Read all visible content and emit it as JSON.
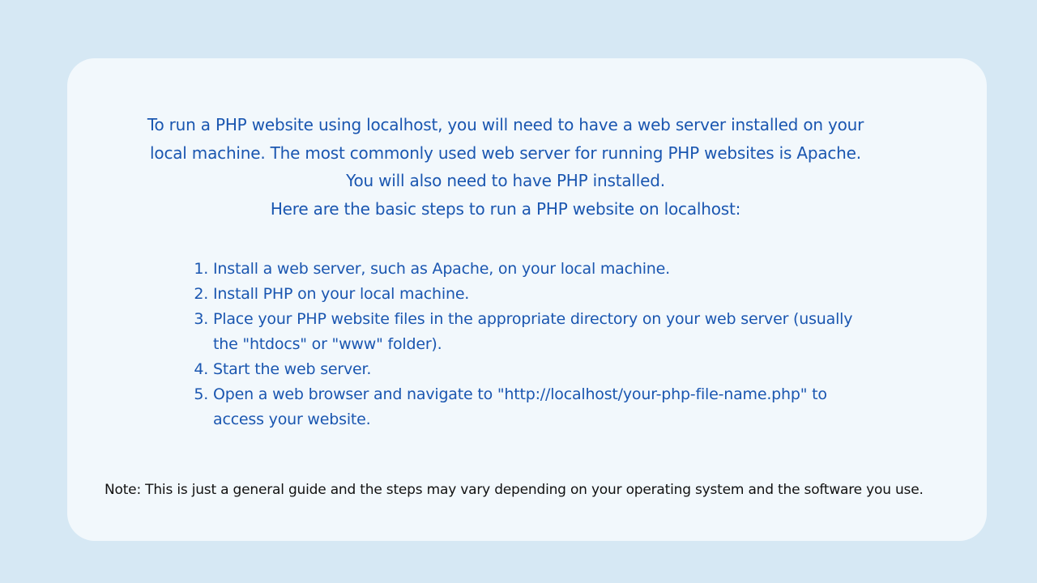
{
  "colors": {
    "background": "#d6e8f4",
    "card": "#f2f8fc",
    "accent_text": "#1a56b0",
    "note_text": "#111111"
  },
  "intro": {
    "paragraph": "To run a PHP website using localhost, you will need to have a web server installed on your local machine. The most commonly used web server for running PHP websites is Apache. You will also need to have PHP installed.",
    "lead": "Here are the basic steps to run a PHP website on localhost:"
  },
  "steps": [
    "Install a web server, such as Apache, on your local machine.",
    "Install PHP on your local machine.",
    "Place your PHP website files in the appropriate directory on your web server (usually the \"htdocs\" or \"www\" folder).",
    "Start the web server.",
    "Open a web browser and navigate to \"http://localhost/your-php-file-name.php\" to access your website."
  ],
  "note": "Note: This is just a general guide and the steps may vary depending on your operating system and the software you use."
}
